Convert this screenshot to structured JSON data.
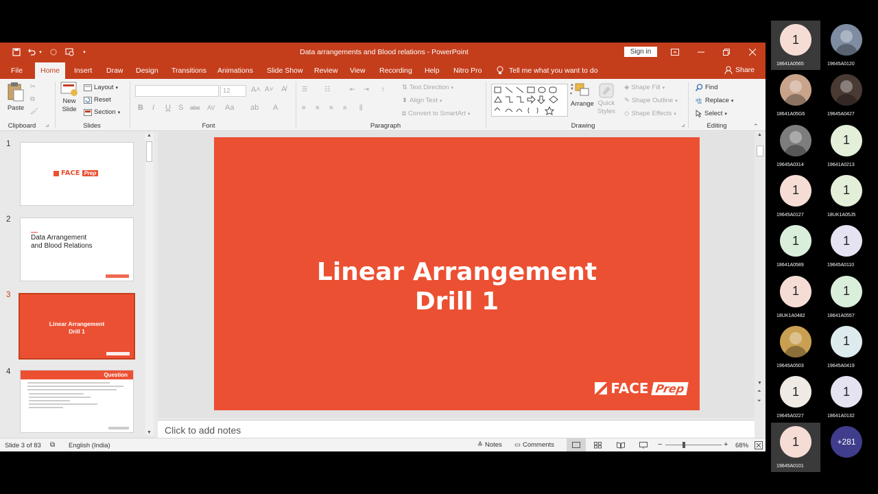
{
  "window": {
    "title": "Data arrangements and Blood relations  -  PowerPoint",
    "signin_label": "Sign in",
    "accent": "#c43e1c"
  },
  "tabs": [
    {
      "label": "File"
    },
    {
      "label": "Home"
    },
    {
      "label": "Insert"
    },
    {
      "label": "Draw"
    },
    {
      "label": "Design"
    },
    {
      "label": "Transitions"
    },
    {
      "label": "Animations"
    },
    {
      "label": "Slide Show"
    },
    {
      "label": "Review"
    },
    {
      "label": "View"
    },
    {
      "label": "Recording"
    },
    {
      "label": "Help"
    },
    {
      "label": "Nitro Pro"
    }
  ],
  "tell_me": "Tell me what you want to do",
  "share_label": "Share",
  "ribbon": {
    "clipboard": {
      "paste": "Paste",
      "group": "Clipboard"
    },
    "slides": {
      "new_slide_1": "New",
      "new_slide_2": "Slide",
      "layout": "Layout",
      "reset": "Reset",
      "section": "Section",
      "group": "Slides"
    },
    "font": {
      "size": "12",
      "group": "Font"
    },
    "paragraph": {
      "text_direction": "Text Direction",
      "align_text": "Align Text",
      "convert": "Convert to SmartArt",
      "group": "Paragraph"
    },
    "drawing": {
      "arrange": "Arrange",
      "quick_1": "Quick",
      "quick_2": "Styles",
      "shape_fill": "Shape Fill",
      "shape_outline": "Shape Outline",
      "shape_effects": "Shape Effects",
      "group": "Drawing"
    },
    "editing": {
      "find": "Find",
      "replace": "Replace",
      "select": "Select",
      "group": "Editing"
    }
  },
  "thumbnails": [
    {
      "num": "1",
      "brand": "FACE",
      "brand2": "Prep"
    },
    {
      "num": "2",
      "line1": "Data Arrangement",
      "line2": "and Blood Relations"
    },
    {
      "num": "3",
      "line1": "Linear Arrangement",
      "line2": "Drill 1"
    },
    {
      "num": "4",
      "header": "Question"
    }
  ],
  "slide": {
    "title_line1": "Linear Arrangement",
    "title_line2": "Drill 1",
    "logo_face": "FACE",
    "logo_prep": "Prep",
    "background": "#ec5032"
  },
  "notes_placeholder": "Click to add notes",
  "status": {
    "slide_info": "Slide 3 of 83",
    "language": "English (India)",
    "notes": "Notes",
    "comments": "Comments",
    "zoom": "68%"
  },
  "participants": [
    {
      "id": "18641A0565",
      "initial": "1",
      "color": "#f5ddd6",
      "photo": false
    },
    {
      "id": "19645A0120",
      "initial": "",
      "color": "#7e8da1",
      "photo": true
    },
    {
      "id": "18641A05G6",
      "initial": "",
      "color": "#c9a48b",
      "photo": true
    },
    {
      "id": "19645A0427",
      "initial": "",
      "color": "#4a3a34",
      "photo": true
    },
    {
      "id": "19645A0314",
      "initial": "",
      "color": "#7d7d7d",
      "photo": true
    },
    {
      "id": "19641A0213",
      "initial": "1",
      "color": "#e3efd8",
      "photo": false
    },
    {
      "id": "19645A0127",
      "initial": "1",
      "color": "#f5ddd6",
      "photo": false
    },
    {
      "id": "18UK1A05J5",
      "initial": "1",
      "color": "#e3efd8",
      "photo": false
    },
    {
      "id": "18641A0589",
      "initial": "1",
      "color": "#d9efdc",
      "photo": false
    },
    {
      "id": "19645A0110",
      "initial": "1",
      "color": "#e5e2f2",
      "photo": false
    },
    {
      "id": "18UK1A0482",
      "initial": "1",
      "color": "#f5ddd6",
      "photo": false
    },
    {
      "id": "18641A0557",
      "initial": "1",
      "color": "#d9efdc",
      "photo": false
    },
    {
      "id": "19645A0503",
      "initial": "",
      "color": "#c9a052",
      "photo": true
    },
    {
      "id": "19645A0419",
      "initial": "1",
      "color": "#ddebef",
      "photo": false
    },
    {
      "id": "19645A0227",
      "initial": "1",
      "color": "#efebe4",
      "photo": false
    },
    {
      "id": "18641A0132",
      "initial": "1",
      "color": "#e5e2f2",
      "photo": false
    },
    {
      "id": "19645A0101",
      "initial": "1",
      "color": "#f5ddd6",
      "photo": false
    },
    {
      "id": "",
      "initial": "+281",
      "color": "#3f3d8c",
      "photo": false
    }
  ]
}
